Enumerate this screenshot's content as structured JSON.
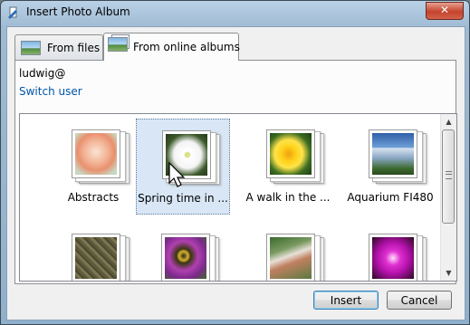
{
  "window": {
    "title": "Insert Photo Album",
    "close_glyph": "✕"
  },
  "tabs": [
    {
      "label": "From files",
      "icon": "photo-icon",
      "active": false
    },
    {
      "label": "From online albums",
      "icon": "photo-stack-icon",
      "active": true
    }
  ],
  "account": {
    "username": "ludwig@",
    "switch_user_label": "Switch user"
  },
  "albums": [
    {
      "label": "Abstracts",
      "thumbnail": "peach-rose-photo",
      "selected": false
    },
    {
      "label": "Spring time in ...",
      "thumbnail": "white-dogwood-flower-photo",
      "selected": true
    },
    {
      "label": "A walk in the ...",
      "thumbnail": "yellow-daffodil-photo",
      "selected": false
    },
    {
      "label": "Aquarium FI480",
      "thumbnail": "blue-glass-building-photo",
      "selected": false
    },
    {
      "label": "",
      "thumbnail": "stone-texture-photo",
      "selected": false
    },
    {
      "label": "",
      "thumbnail": "bee-on-purple-flower-photo",
      "selected": false
    },
    {
      "label": "",
      "thumbnail": "people-outdoors-photo",
      "selected": false
    },
    {
      "label": "",
      "thumbnail": "magenta-orchid-photo",
      "selected": false
    }
  ],
  "buttons": {
    "insert_label": "Insert",
    "cancel_label": "Cancel"
  },
  "colors": {
    "link": "#0055a8",
    "selection": "#d8e6f5",
    "close_button": "#c4442d"
  }
}
